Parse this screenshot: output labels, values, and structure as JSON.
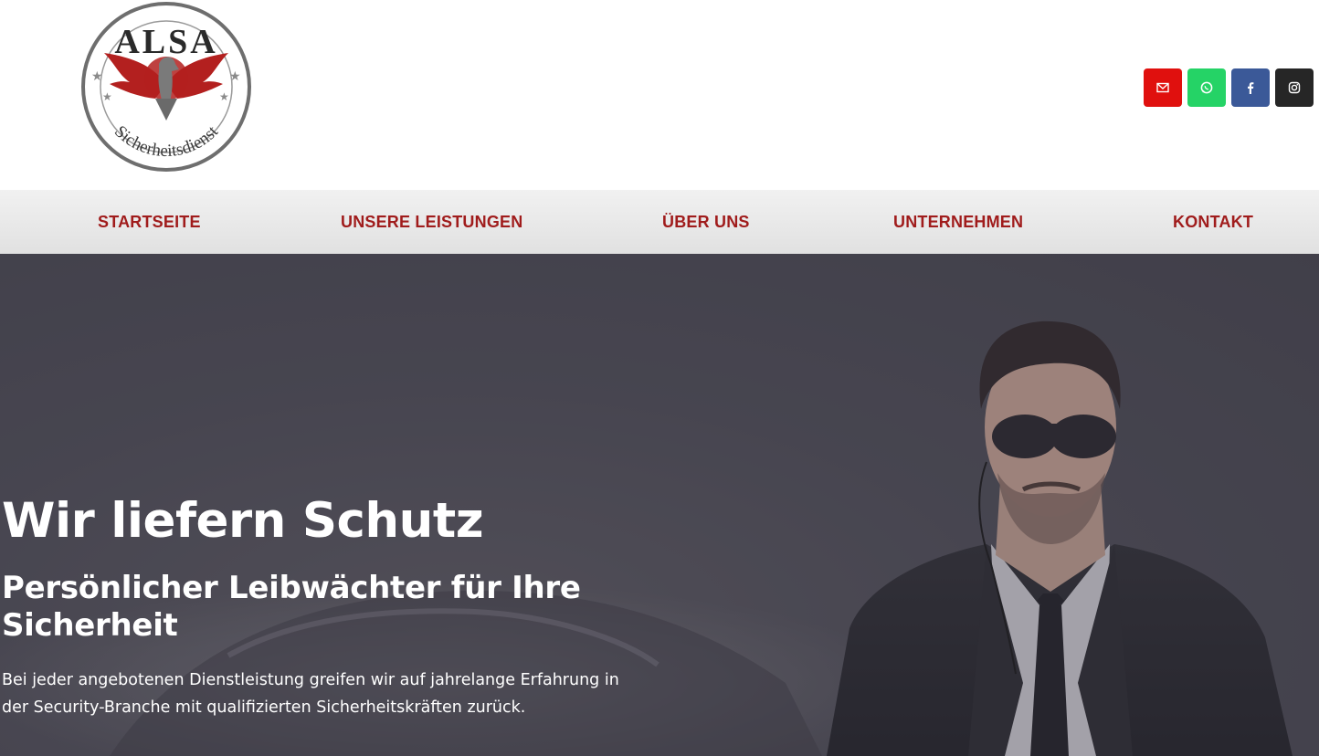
{
  "logo": {
    "top_text": "ALSA",
    "ring_text": "Sicherheitsdienst"
  },
  "social": [
    {
      "name": "mail-icon",
      "color": "#e0100e"
    },
    {
      "name": "whatsapp-icon",
      "color": "#25d366"
    },
    {
      "name": "facebook-icon",
      "color": "#3b5998"
    },
    {
      "name": "instagram-icon",
      "color": "#262626"
    }
  ],
  "nav": {
    "items": [
      "STARTSEITE",
      "UNSERE LEISTUNGEN",
      "ÜBER UNS",
      "UNTERNEHMEN",
      "KONTAKT"
    ],
    "color": "#a01c1c"
  },
  "hero": {
    "title": "Wir liefern Schutz",
    "subtitle": "Persönlicher Leibwächter für Ihre Sicherheit",
    "text": "Bei jeder angebotenen Dienstleistung greifen wir auf jahrelange Erfahrung in der Security-Branche mit qualifizierten Sicherheitskräften zurück."
  }
}
